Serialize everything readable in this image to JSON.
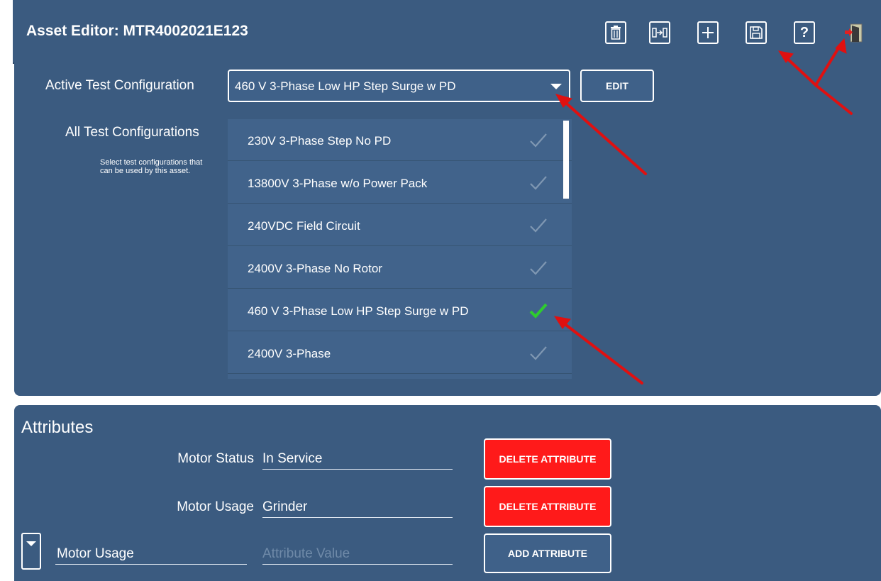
{
  "header": {
    "title": "Asset Editor: MTR4002021E123",
    "buttons": [
      "delete-asset",
      "copy-asset",
      "add-asset",
      "save-asset",
      "help",
      "exit"
    ]
  },
  "config": {
    "active_label": "Active Test Configuration",
    "active_value": "460 V 3-Phase Low HP Step Surge w PD",
    "edit_label": "EDIT",
    "all_label": "All Test Configurations",
    "hint": "Select test configurations that can be used by this asset.",
    "items": [
      {
        "name": "230V 3-Phase Step No PD",
        "checked": false
      },
      {
        "name": "13800V 3-Phase w/o Power Pack",
        "checked": false
      },
      {
        "name": "240VDC Field Circuit",
        "checked": false
      },
      {
        "name": "2400V 3-Phase No Rotor",
        "checked": false
      },
      {
        "name": "460 V 3-Phase Low HP Step Surge w PD",
        "checked": true
      },
      {
        "name": "2400V 3-Phase",
        "checked": false
      }
    ]
  },
  "attributes": {
    "heading": "Attributes",
    "rows": [
      {
        "label": "Motor Status",
        "value": "In Service",
        "button": "DELETE ATTRIBUTE"
      },
      {
        "label": "Motor Usage",
        "value": "Grinder",
        "button": "DELETE ATTRIBUTE"
      }
    ],
    "new_row": {
      "key": "Motor Usage",
      "value_placeholder": "Attribute Value",
      "button": "ADD ATTRIBUTE"
    }
  },
  "colors": {
    "panel": "#3b5b80",
    "list": "#41638b",
    "delete": "#ff1a1a",
    "check_active": "#2ecc2e",
    "annotation_arrow": "#e01010"
  }
}
